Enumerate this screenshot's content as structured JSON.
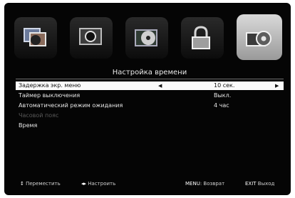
{
  "tabs": [
    {
      "icon": "pictures-icon"
    },
    {
      "icon": "camera-icon"
    },
    {
      "icon": "disc-icon"
    },
    {
      "icon": "lock-icon"
    },
    {
      "icon": "gear-icon",
      "active": true
    }
  ],
  "menu": {
    "title": "Настройка времени",
    "items": [
      {
        "label": "Задержка экр. меню",
        "value": "10 сек.",
        "selected": true
      },
      {
        "label": "Таймер выключения",
        "value": "Выкл."
      },
      {
        "label": "Автоматический режим ожидания",
        "value": "4 час"
      },
      {
        "label": "Часовой пояс",
        "value": "",
        "disabled": true
      },
      {
        "label": "Время",
        "value": ""
      }
    ]
  },
  "footer": {
    "move": "Переместить",
    "adjust": "Настроить",
    "menu_key": "MENU",
    "back": "Возврат",
    "exit_key": "EXIT",
    "exit": "Выход"
  }
}
